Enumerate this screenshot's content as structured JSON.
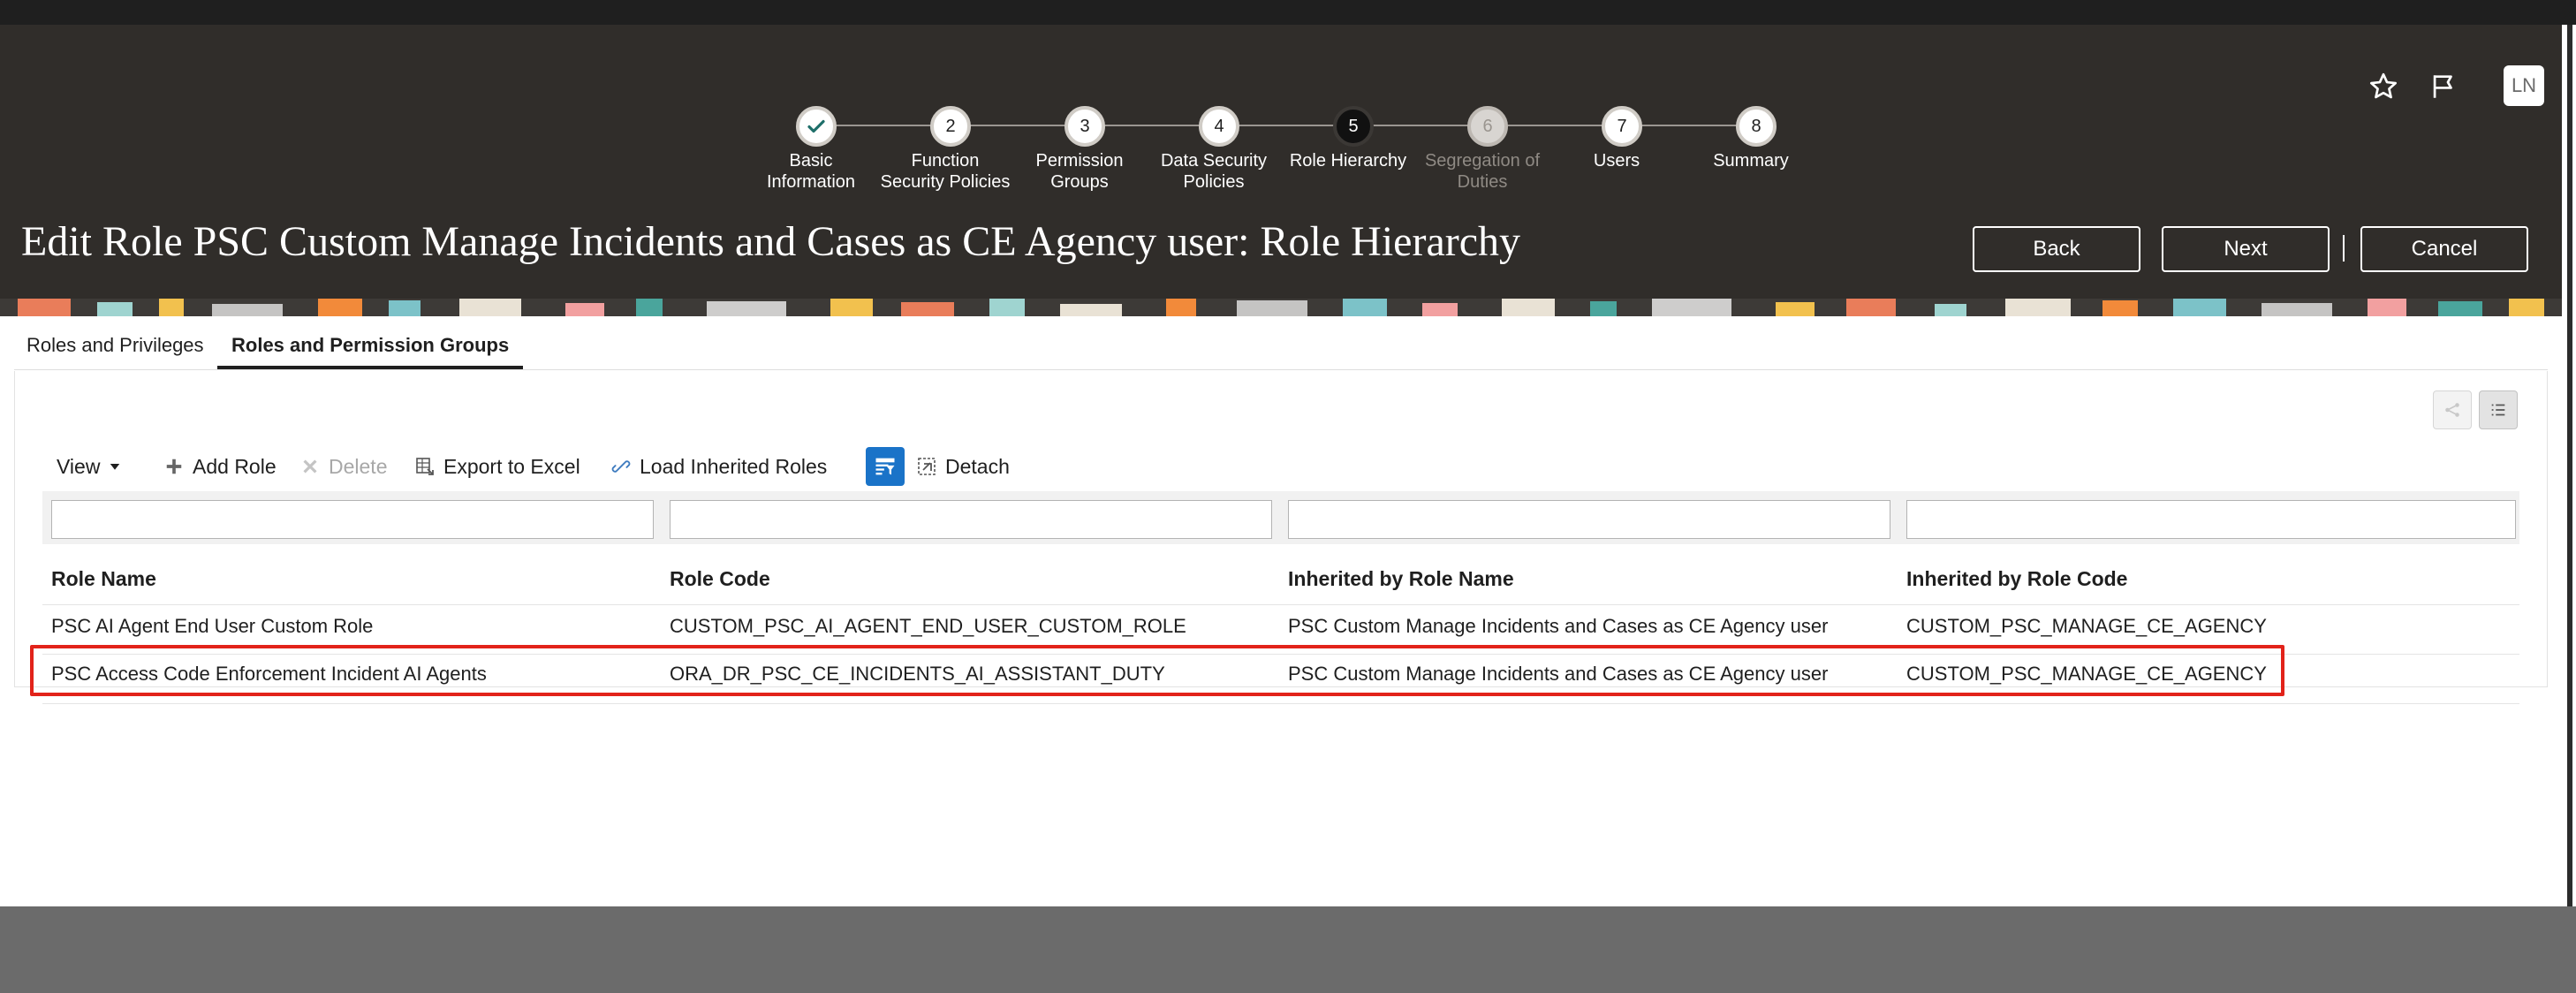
{
  "header": {
    "avatar_initials": "LN",
    "icons": [
      "star-icon",
      "flag-icon"
    ],
    "title": "Edit Role PSC Custom Manage Incidents and Cases as CE Agency user: Role Hierarchy",
    "buttons": {
      "back": "Back",
      "next": "Next",
      "cancel": "Cancel"
    }
  },
  "train": {
    "stops": [
      {
        "number": "",
        "label_line1": "Basic",
        "label_line2": "Information",
        "state": "done"
      },
      {
        "number": "2",
        "label_line1": "Function",
        "label_line2": "Security Policies",
        "state": "visited"
      },
      {
        "number": "3",
        "label_line1": "Permission",
        "label_line2": "Groups",
        "state": "visited"
      },
      {
        "number": "4",
        "label_line1": "Data Security",
        "label_line2": "Policies",
        "state": "visited"
      },
      {
        "number": "5",
        "label_line1": "Role Hierarchy",
        "label_line2": "",
        "state": "current"
      },
      {
        "number": "6",
        "label_line1": "Segregation of",
        "label_line2": "Duties",
        "state": "disabled"
      },
      {
        "number": "7",
        "label_line1": "Users",
        "label_line2": "",
        "state": "visited"
      },
      {
        "number": "8",
        "label_line1": "Summary",
        "label_line2": "",
        "state": "visited"
      }
    ]
  },
  "tabs": [
    {
      "label": "Roles and Privileges",
      "active": false
    },
    {
      "label": "Roles and Permission Groups",
      "active": true
    }
  ],
  "toolbar": {
    "view": "View",
    "add_role": "Add Role",
    "delete": "Delete",
    "export": "Export to Excel",
    "load_inherited": "Load Inherited Roles",
    "detach": "Detach"
  },
  "table": {
    "columns": [
      "Role Name",
      "Role Code",
      "Inherited by Role Name",
      "Inherited by Role Code"
    ],
    "filters": [
      "",
      "",
      "",
      ""
    ],
    "rows": [
      [
        "PSC AI Agent End User Custom Role",
        "CUSTOM_PSC_AI_AGENT_END_USER_CUSTOM_ROLE",
        "PSC Custom Manage Incidents and Cases as CE Agency user",
        "CUSTOM_PSC_MANAGE_CE_AGENCY"
      ],
      [
        "PSC Access Code Enforcement Incident AI Agents",
        "ORA_DR_PSC_CE_INCIDENTS_AI_ASSISTANT_DUTY",
        "PSC Custom Manage Incidents and Cases as CE Agency user",
        "CUSTOM_PSC_MANAGE_CE_AGENCY"
      ]
    ]
  },
  "colors": {
    "header_bg": "#302d2a",
    "highlight": "#e2231a",
    "accent_blue": "#1a73c8"
  }
}
